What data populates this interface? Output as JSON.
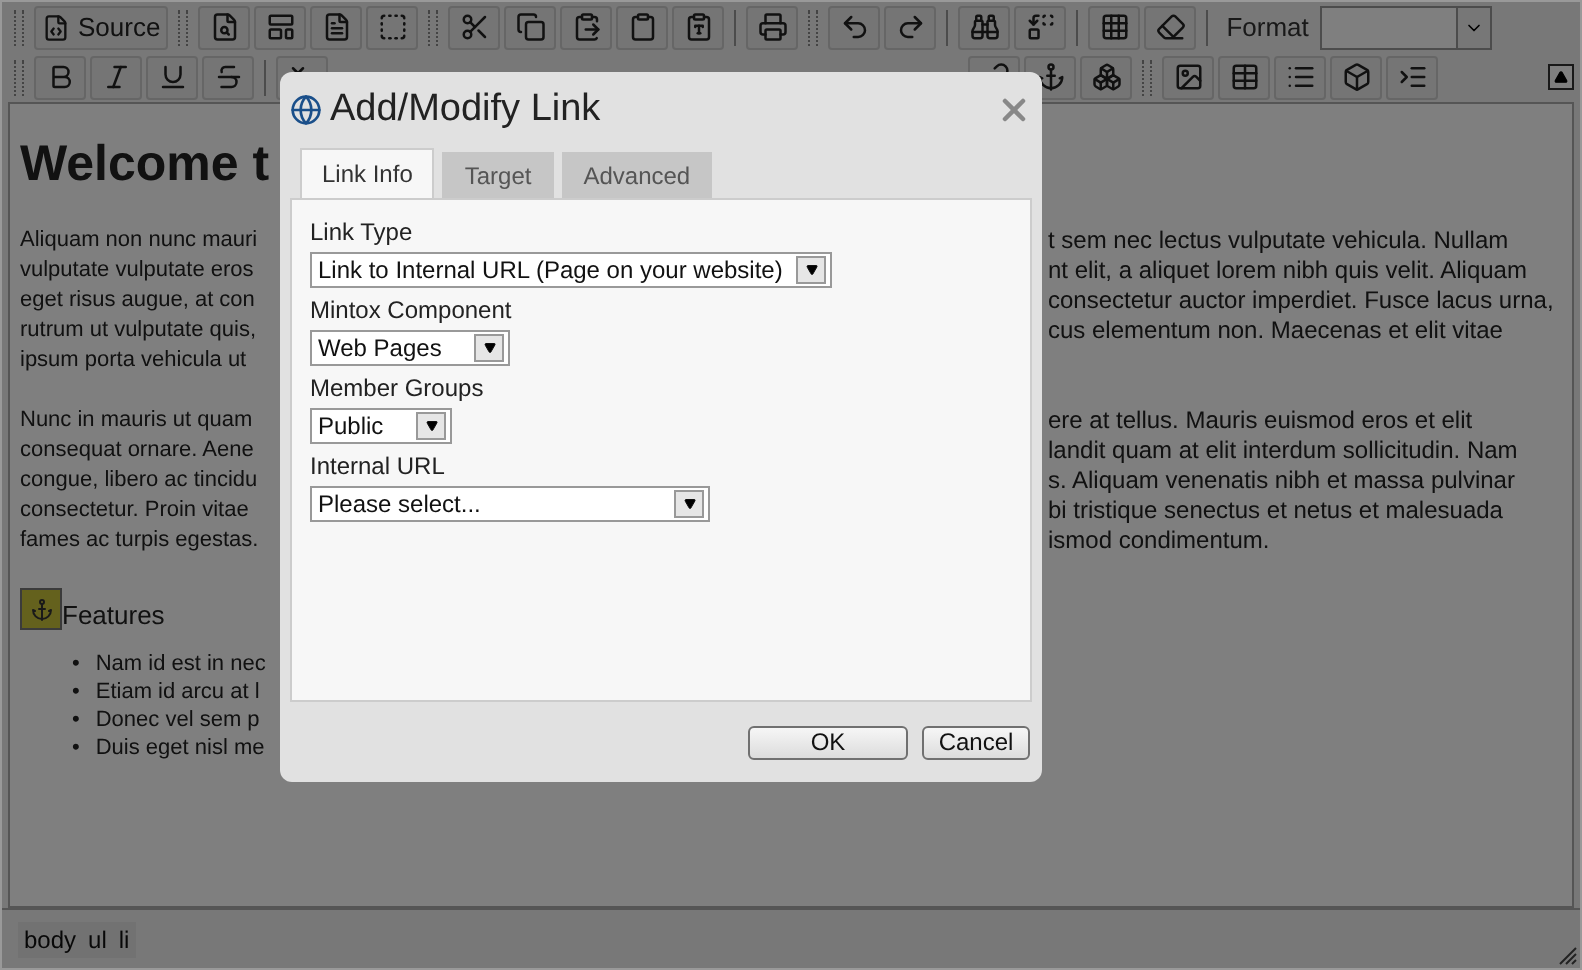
{
  "toolbar": {
    "source_button": "Source",
    "format_label": "Format"
  },
  "editor": {
    "heading": "Welcome t",
    "paragraphs": [
      {
        "left_lines": [
          "Aliquam non nunc mauri",
          "vulputate vulputate eros",
          "eget risus augue, at con",
          "rutrum ut vulputate quis,",
          "ipsum porta vehicula ut"
        ],
        "right_lines": [
          "t sem nec lectus vulputate vehicula. Nullam",
          "nt elit, a aliquet lorem nibh quis velit. Aliquam",
          "consectetur auctor imperdiet. Fusce lacus urna,",
          "cus elementum non. Maecenas et elit vitae"
        ]
      },
      {
        "left_lines": [
          "Nunc in mauris ut quam",
          "consequat ornare. Aene",
          "congue, libero ac tincidu",
          "consectetur. Proin vitae",
          "fames ac turpis egestas."
        ],
        "right_lines": [
          "ere at tellus. Mauris euismod eros et elit",
          "landit quam at elit interdum sollicitudin. Nam",
          "s. Aliquam venenatis nibh et massa pulvinar",
          "bi tristique senectus et netus et malesuada",
          "ismod condimentum."
        ]
      }
    ],
    "feature_label": "Features",
    "bullets": [
      {
        "marker": "•",
        "text": "Nam id est in nec"
      },
      {
        "marker": "•",
        "text": "Etiam id arcu at l"
      },
      {
        "marker": "•",
        "text": "Donec vel sem p"
      },
      {
        "marker": "•",
        "text": "Duis eget nisl me"
      }
    ]
  },
  "status_path": [
    "body",
    "ul",
    "li"
  ],
  "dialog": {
    "title": "Add/Modify Link",
    "tabs": [
      {
        "label": "Link Info",
        "selected": true
      },
      {
        "label": "Target",
        "selected": false
      },
      {
        "label": "Advanced",
        "selected": false
      }
    ],
    "fields": [
      {
        "label": "Link Type",
        "value": "Link to Internal URL (Page on your website)"
      },
      {
        "label": "Mintox Component",
        "value": "Web Pages"
      },
      {
        "label": "Member Groups",
        "value": "Public"
      },
      {
        "label": "Internal URL",
        "value": "Please select..."
      }
    ],
    "buttons": [
      "OK",
      "Cancel"
    ]
  }
}
